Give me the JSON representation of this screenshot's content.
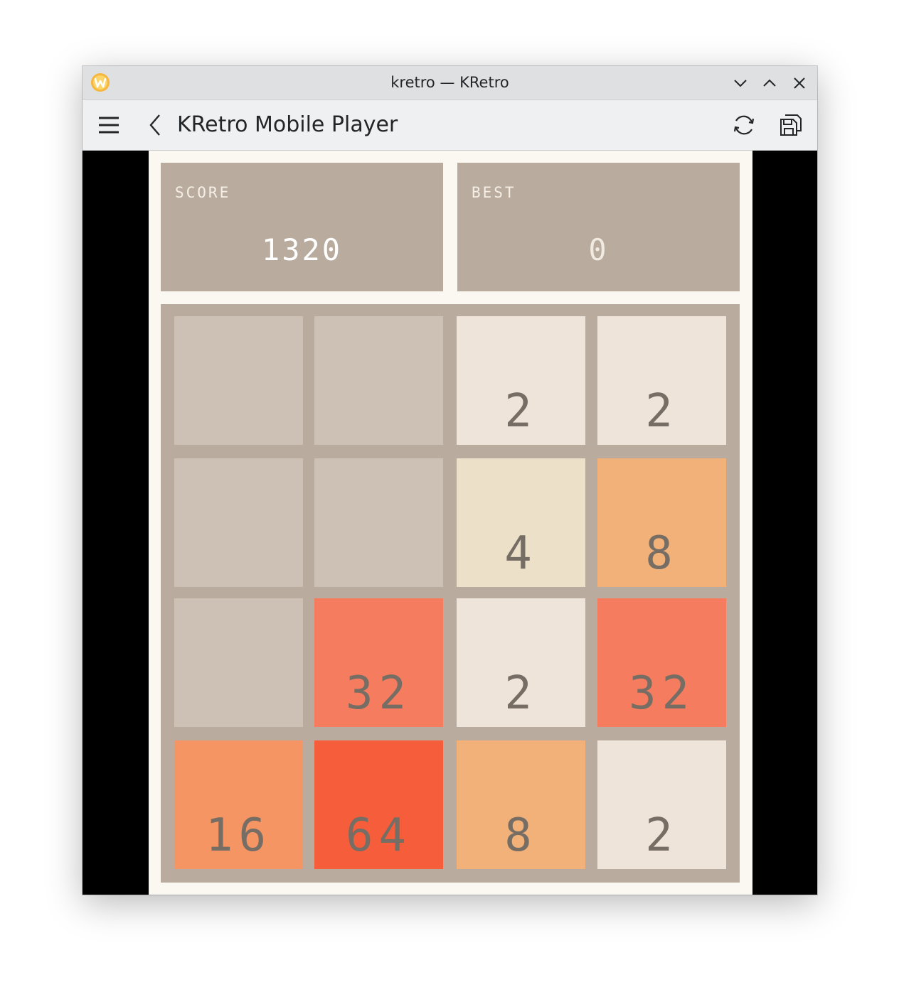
{
  "window": {
    "title": "kretro — KRetro"
  },
  "toolbar": {
    "page_title": "KRetro Mobile Player",
    "icons": [
      "hamburger-menu-icon",
      "back-chevron-icon",
      "reload-icon",
      "save-state-icon"
    ]
  },
  "game": {
    "score_label": "SCORE",
    "score_value": "1320",
    "best_label": "BEST",
    "best_value": "0",
    "board": [
      [
        "",
        "",
        "2",
        "2"
      ],
      [
        "",
        "",
        "4",
        "8"
      ],
      [
        "",
        "32",
        "2",
        "32"
      ],
      [
        "16",
        "64",
        "8",
        "2"
      ]
    ],
    "tile_colors": {
      "empty": "#cdc1b5",
      "2": "#eee4da",
      "4": "#ede0c8",
      "8": "#f2b179",
      "16": "#f59563",
      "32": "#f67c5f",
      "64": "#f65e3b"
    },
    "board_color": "#b9ab9d",
    "background_color": "#faf8f0"
  }
}
